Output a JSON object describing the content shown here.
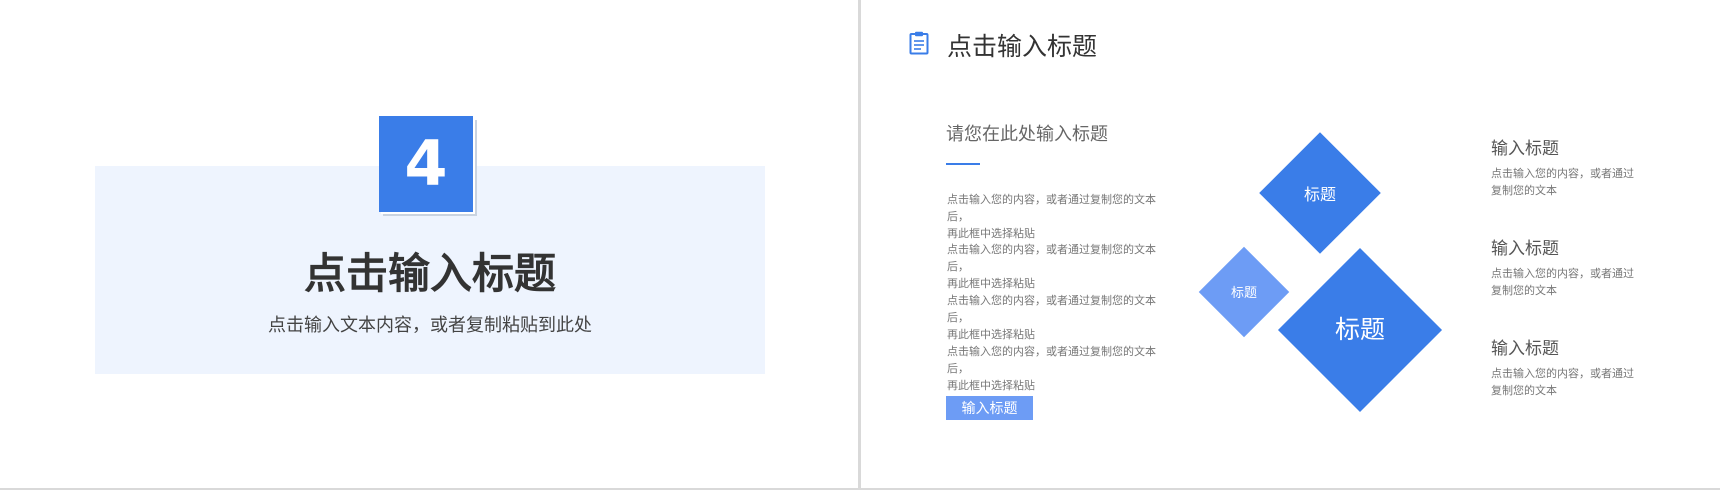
{
  "left_slide": {
    "number": "4",
    "title": "点击输入标题",
    "subtitle": "点击输入文本内容，或者复制粘贴到此处"
  },
  "right_slide": {
    "header_title": "点击输入标题",
    "section_title": "请您在此处输入标题",
    "paragraphs": [
      {
        "line1": "点击输入您的内容，或者通过复制您的文本后，",
        "line2": "再此框中选择粘贴"
      },
      {
        "line1": "点击输入您的内容，或者通过复制您的文本后，",
        "line2": "再此框中选择粘贴"
      },
      {
        "line1": "点击输入您的内容，或者通过复制您的文本后，",
        "line2": "再此框中选择粘贴"
      },
      {
        "line1": "点击输入您的内容，或者通过复制您的文本后，",
        "line2": "再此框中选择粘贴"
      }
    ],
    "button_label": "输入标题",
    "diamonds": {
      "top": "标题",
      "small": "标题",
      "large": "标题"
    },
    "side_items": [
      {
        "title": "输入标题",
        "line1": "点击输入您的内容，或者通过",
        "line2": "复制您的文本"
      },
      {
        "title": "输入标题",
        "line1": "点击输入您的内容，或者通过",
        "line2": "复制您的文本"
      },
      {
        "title": "输入标题",
        "line1": "点击输入您的内容，或者通过",
        "line2": "复制您的文本"
      }
    ]
  },
  "colors": {
    "accent": "#3a7de8",
    "accent_light": "#6d9cf5",
    "panel_bg": "#eef4fe",
    "divider": "#d9d9d9"
  },
  "icons": {
    "header_icon": "clipboard-icon"
  }
}
